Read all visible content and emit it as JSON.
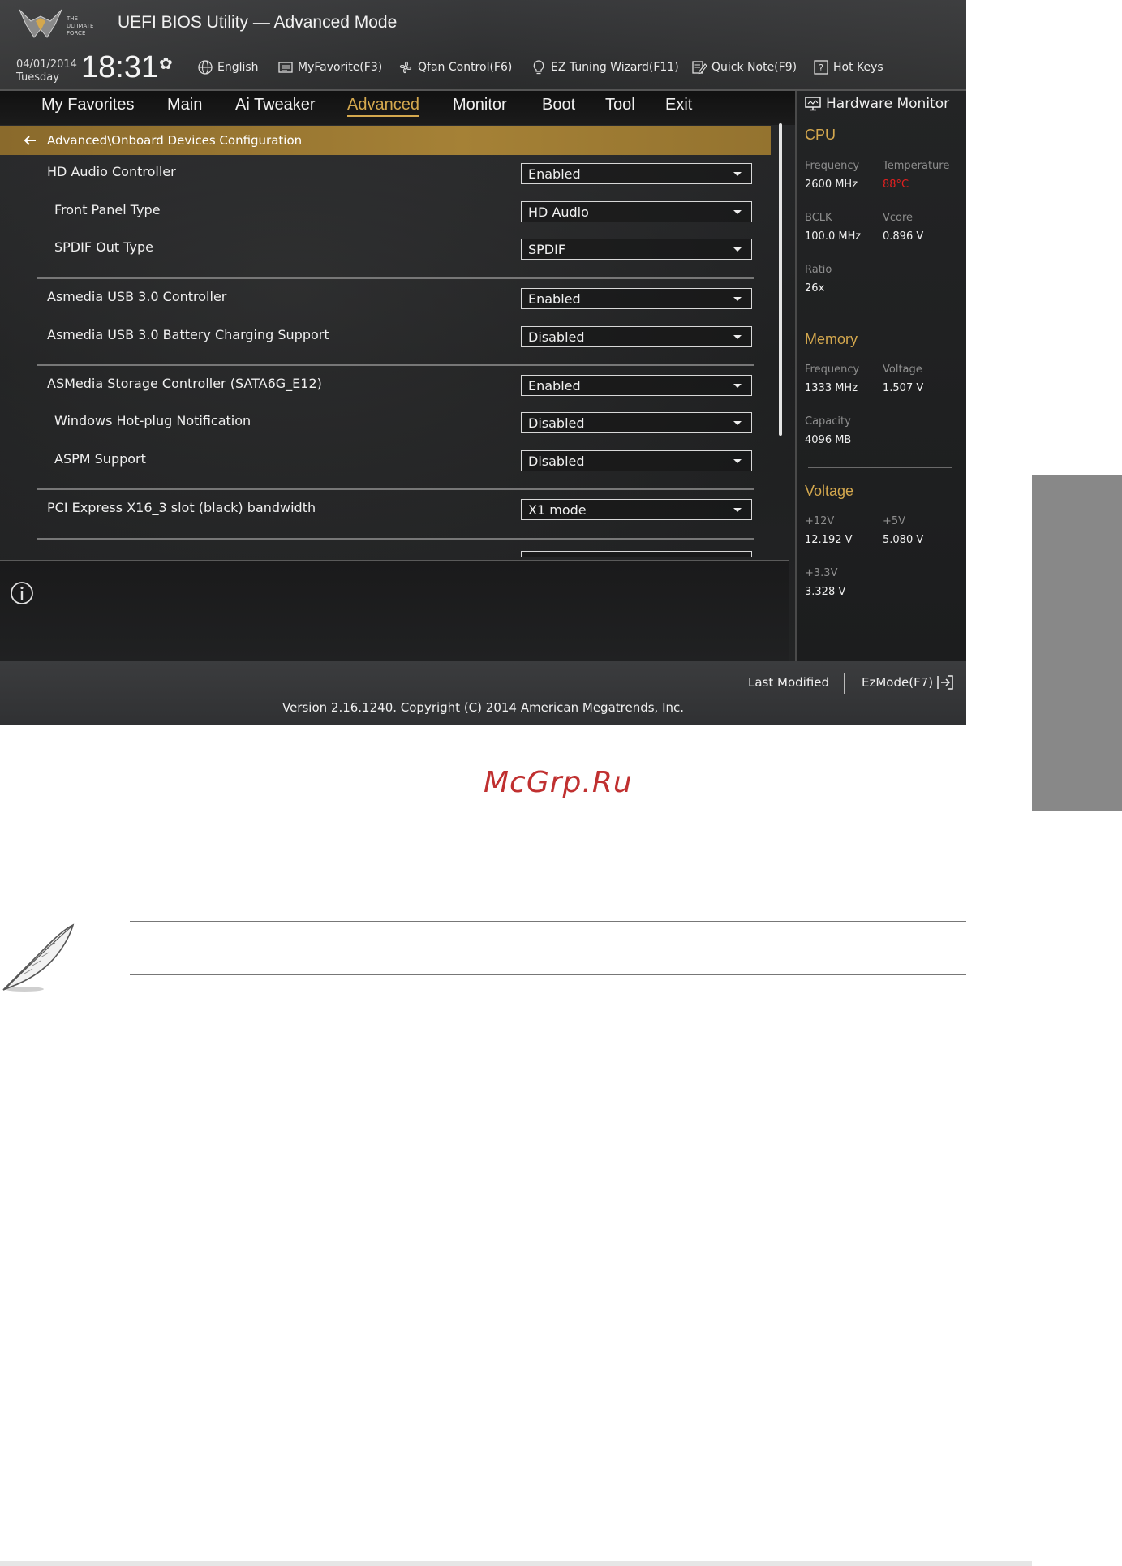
{
  "header": {
    "logo_text": "THE ULTIMATE FORCE",
    "title": "UEFI BIOS Utility — Advanced Mode",
    "date": "04/01/2014",
    "weekday": "Tuesday",
    "time": "18:31",
    "language": "English",
    "myfavorite": "MyFavorite(F3)",
    "qfan": "Qfan Control(F6)",
    "ez_tuning": "EZ Tuning Wizard(F11)",
    "quick_note": "Quick Note(F9)",
    "hot_keys": "Hot Keys"
  },
  "nav": {
    "tabs": [
      "My Favorites",
      "Main",
      "Ai Tweaker",
      "Advanced",
      "Monitor",
      "Boot",
      "Tool",
      "Exit"
    ],
    "active": "Advanced"
  },
  "breadcrumb": "Advanced\\Onboard Devices Configuration",
  "settings": [
    {
      "label": "HD Audio Controller",
      "value": "Enabled"
    },
    {
      "label": "Front Panel Type",
      "value": "HD Audio"
    },
    {
      "label": "SPDIF Out Type",
      "value": "SPDIF"
    },
    {
      "label": "Asmedia USB 3.0 Controller",
      "value": "Enabled"
    },
    {
      "label": "Asmedia USB 3.0 Battery Charging Support",
      "value": "Disabled"
    },
    {
      "label": "ASMedia Storage Controller (SATA6G_E12)",
      "value": "Enabled"
    },
    {
      "label": "Windows Hot-plug Notification",
      "value": "Disabled"
    },
    {
      "label": "ASPM Support",
      "value": "Disabled"
    },
    {
      "label": "PCI Express X16_3 slot (black) bandwidth",
      "value": "X1 mode"
    }
  ],
  "hardware_monitor": {
    "title": "Hardware Monitor",
    "cpu": {
      "heading": "CPU",
      "frequency_label": "Frequency",
      "frequency": "2600 MHz",
      "temperature_label": "Temperature",
      "temperature": "88°C",
      "bclk_label": "BCLK",
      "bclk": "100.0 MHz",
      "vcore_label": "Vcore",
      "vcore": "0.896 V",
      "ratio_label": "Ratio",
      "ratio": "26x"
    },
    "memory": {
      "heading": "Memory",
      "frequency_label": "Frequency",
      "frequency": "1333 MHz",
      "voltage_label": "Voltage",
      "voltage": "1.507 V",
      "capacity_label": "Capacity",
      "capacity": "4096 MB"
    },
    "voltage": {
      "heading": "Voltage",
      "v12_label": "+12V",
      "v12": "12.192 V",
      "v5_label": "+5V",
      "v5": "5.080 V",
      "v33_label": "+3.3V",
      "v33": "3.328 V"
    }
  },
  "footer": {
    "last_modified": "Last Modified",
    "ezmode": "EzMode(F7)",
    "version": "Version 2.16.1240. Copyright (C) 2014 American Megatrends, Inc."
  },
  "watermark": "McGrp.Ru",
  "colors": {
    "accent": "#d4a84e",
    "temperature_alert": "#e02020",
    "watermark": "#c03030"
  }
}
